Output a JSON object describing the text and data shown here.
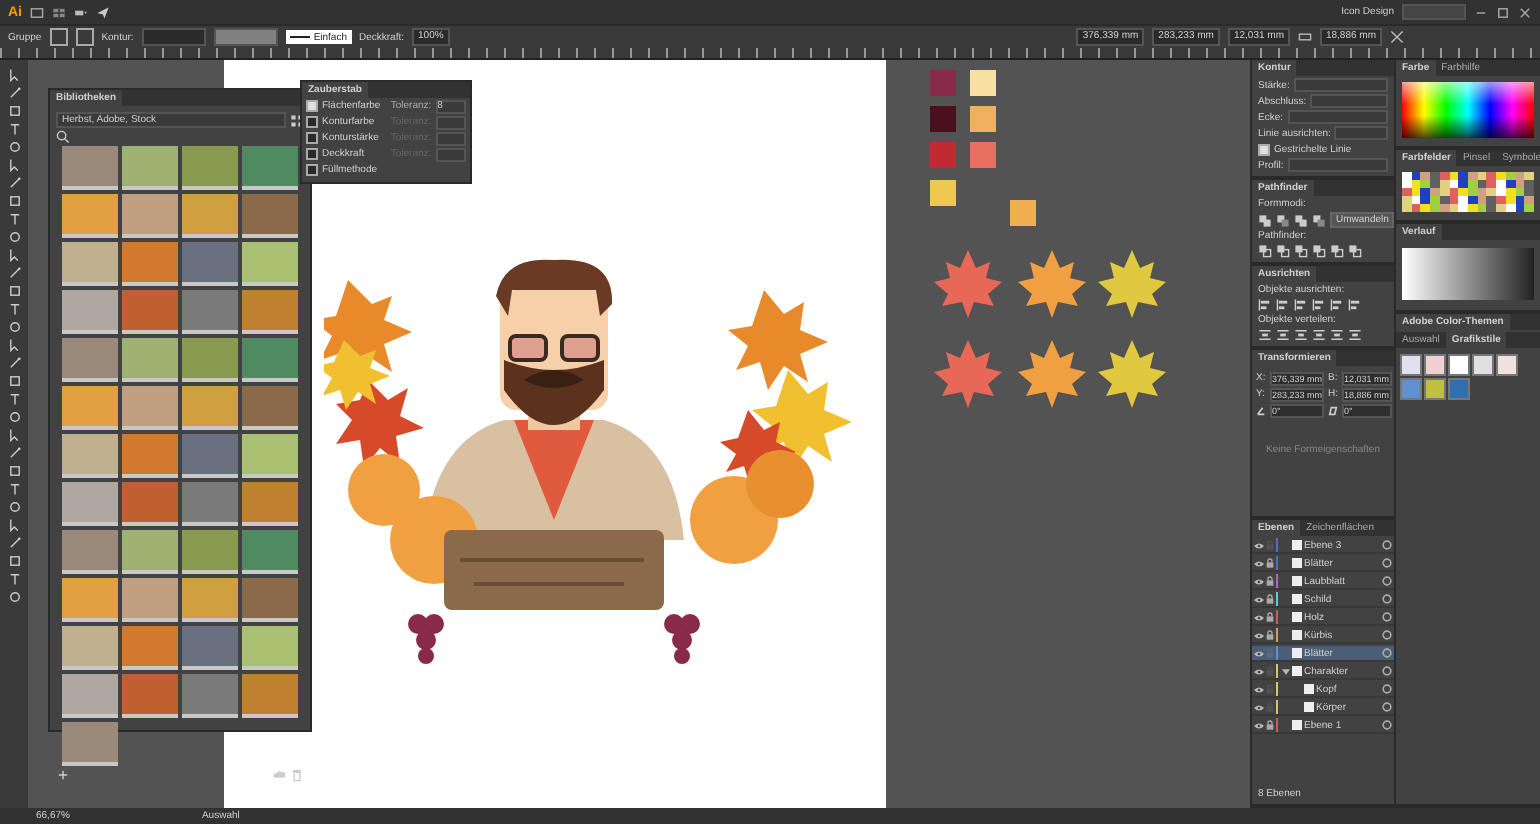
{
  "app": {
    "logo": "Ai",
    "workspace": "Icon Design"
  },
  "control_bar": {
    "selection": "Gruppe",
    "stroke_label": "Kontur:",
    "stroke_style": "Einfach",
    "opacity_label": "Deckkraft:",
    "opacity": "100%",
    "x": "376,339 mm",
    "y": "283,233 mm",
    "w": "12,031 mm",
    "h": "18,886 mm"
  },
  "library_panel": {
    "title": "Bibliotheken",
    "library": "Herbst, Adobe, Stock"
  },
  "magic_wand_panel": {
    "title": "Zauberstab",
    "options": [
      {
        "label": "Flächenfarbe",
        "checked": true,
        "tolerance_label": "Toleranz:",
        "tolerance": "8"
      },
      {
        "label": "Konturfarbe",
        "checked": false,
        "tolerance_label": "Toleranz:"
      },
      {
        "label": "Konturstärke",
        "checked": false,
        "tolerance_label": "Toleranz:"
      },
      {
        "label": "Deckkraft",
        "checked": false,
        "tolerance_label": "Toleranz:"
      },
      {
        "label": "Füllmethode",
        "checked": false
      }
    ]
  },
  "stroke_panel": {
    "title": "Kontur",
    "fields": [
      "Stärke:",
      "Abschluss:",
      "Ecke:",
      "Linie ausrichten:"
    ],
    "dashed_label": "Gestrichelte Linie",
    "dashed": true,
    "profile_label": "Profil:"
  },
  "pathfinder_panel": {
    "title": "Pathfinder",
    "shape_modes": "Formmodi:",
    "expand": "Umwandeln",
    "pathfinders": "Pathfinder:"
  },
  "align_panel": {
    "title": "Ausrichten",
    "align_label": "Objekte ausrichten:",
    "distribute_label": "Objekte verteilen:"
  },
  "transform_panel": {
    "title": "Transformieren",
    "fields": [
      {
        "label": "X:",
        "value": "376,339 mm"
      },
      {
        "label": "B:",
        "value": "12,031 mm"
      },
      {
        "label": "Y:",
        "value": "283,233 mm"
      },
      {
        "label": "H:",
        "value": "18,886 mm"
      }
    ],
    "angle": "0°",
    "shear": "0°",
    "note": "Keine Formeigenschaften"
  },
  "color_panel": {
    "tabs": [
      {
        "label": "Farbe",
        "selected": true
      },
      {
        "label": "Farbhilfe",
        "selected": false
      }
    ]
  },
  "swatches_panel": {
    "tabs": [
      {
        "label": "Farbfelder",
        "selected": true
      },
      {
        "label": "Pinsel",
        "selected": false
      },
      {
        "label": "Symbole",
        "selected": false
      }
    ]
  },
  "gradient_panel": {
    "title": "Verlauf"
  },
  "themes_panel": {
    "title": "Adobe Color-Themen",
    "tabs": [
      {
        "label": "Auswahl",
        "selected": false
      },
      {
        "label": "Grafikstile",
        "selected": true
      }
    ]
  },
  "layers_panel": {
    "tabs": [
      {
        "label": "Ebenen",
        "selected": true
      },
      {
        "label": "Zeichenflächen",
        "selected": false
      }
    ],
    "layers": [
      {
        "name": "Ebene 3",
        "color": "#4f6dd1",
        "locked": false,
        "selected": false
      },
      {
        "name": "Blätter",
        "color": "#4f6dd1",
        "locked": true,
        "selected": false
      },
      {
        "name": "Laubblatt",
        "color": "#c05ad0",
        "locked": true,
        "selected": false
      },
      {
        "name": "Schild",
        "color": "#5ad0c8",
        "locked": true,
        "selected": false
      },
      {
        "name": "Holz",
        "color": "#d05a5a",
        "locked": true,
        "selected": false
      },
      {
        "name": "Kürbis",
        "color": "#d0a05a",
        "locked": true,
        "selected": false
      },
      {
        "name": "Blätter",
        "color": "#6a8ad8",
        "locked": false,
        "selected": true
      },
      {
        "name": "Charakter",
        "color": "#d0c85a",
        "locked": false,
        "selected": false,
        "expanded": true,
        "children": [
          {
            "name": "Kopf",
            "color": "#d0c85a",
            "locked": false,
            "selected": false
          },
          {
            "name": "Körper",
            "color": "#d0c85a",
            "locked": false,
            "selected": false
          }
        ]
      },
      {
        "name": "Ebene 1",
        "color": "#d05a5a",
        "locked": true,
        "selected": false
      }
    ],
    "footer": "8 Ebenen"
  },
  "status_bar": {
    "zoom": "66,67%",
    "tool": "Auswahl"
  }
}
